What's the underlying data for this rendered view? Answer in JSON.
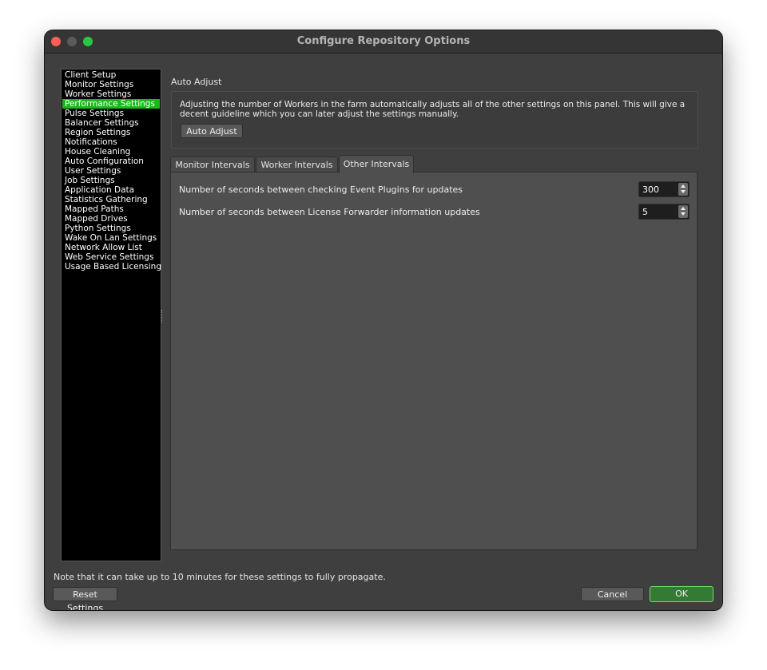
{
  "window": {
    "title": "Configure Repository Options"
  },
  "sidebar": {
    "items": [
      {
        "label": "Client Setup",
        "selected": false
      },
      {
        "label": "Monitor Settings",
        "selected": false
      },
      {
        "label": "Worker Settings",
        "selected": false
      },
      {
        "label": "Performance Settings",
        "selected": true
      },
      {
        "label": "Pulse Settings",
        "selected": false
      },
      {
        "label": "Balancer Settings",
        "selected": false
      },
      {
        "label": "Region Settings",
        "selected": false
      },
      {
        "label": "Notifications",
        "selected": false
      },
      {
        "label": "House Cleaning",
        "selected": false
      },
      {
        "label": "Auto Configuration",
        "selected": false
      },
      {
        "label": "User Settings",
        "selected": false
      },
      {
        "label": "Job Settings",
        "selected": false
      },
      {
        "label": "Application Data",
        "selected": false
      },
      {
        "label": "Statistics Gathering",
        "selected": false
      },
      {
        "label": "Mapped Paths",
        "selected": false
      },
      {
        "label": "Mapped Drives",
        "selected": false
      },
      {
        "label": "Python Settings",
        "selected": false
      },
      {
        "label": "Wake On Lan Settings",
        "selected": false
      },
      {
        "label": "Network Allow List",
        "selected": false
      },
      {
        "label": "Web Service Settings",
        "selected": false
      },
      {
        "label": "Usage Based Licensing",
        "selected": false
      }
    ],
    "selected_color": "#19b91a"
  },
  "auto_adjust": {
    "section_label": "Auto Adjust",
    "description": "Adjusting the number of Workers in the farm automatically adjusts all of the other settings on this panel. This will give a decent guideline which you can later adjust the settings manually.",
    "button_label": "Auto Adjust"
  },
  "tabs": [
    {
      "label": "Monitor Intervals",
      "active": false
    },
    {
      "label": "Worker Intervals",
      "active": false
    },
    {
      "label": "Other Intervals",
      "active": true
    }
  ],
  "other_intervals": {
    "settings": [
      {
        "label": "Number of seconds between checking Event Plugins for updates",
        "value": "300"
      },
      {
        "label": "Number of seconds between License Forwarder information updates",
        "value": "5"
      }
    ]
  },
  "footer": {
    "note": "Note that it can take up to 10 minutes for these settings to fully propagate.",
    "reset_label": "Reset Settings",
    "cancel_label": "Cancel",
    "ok_label": "OK"
  }
}
